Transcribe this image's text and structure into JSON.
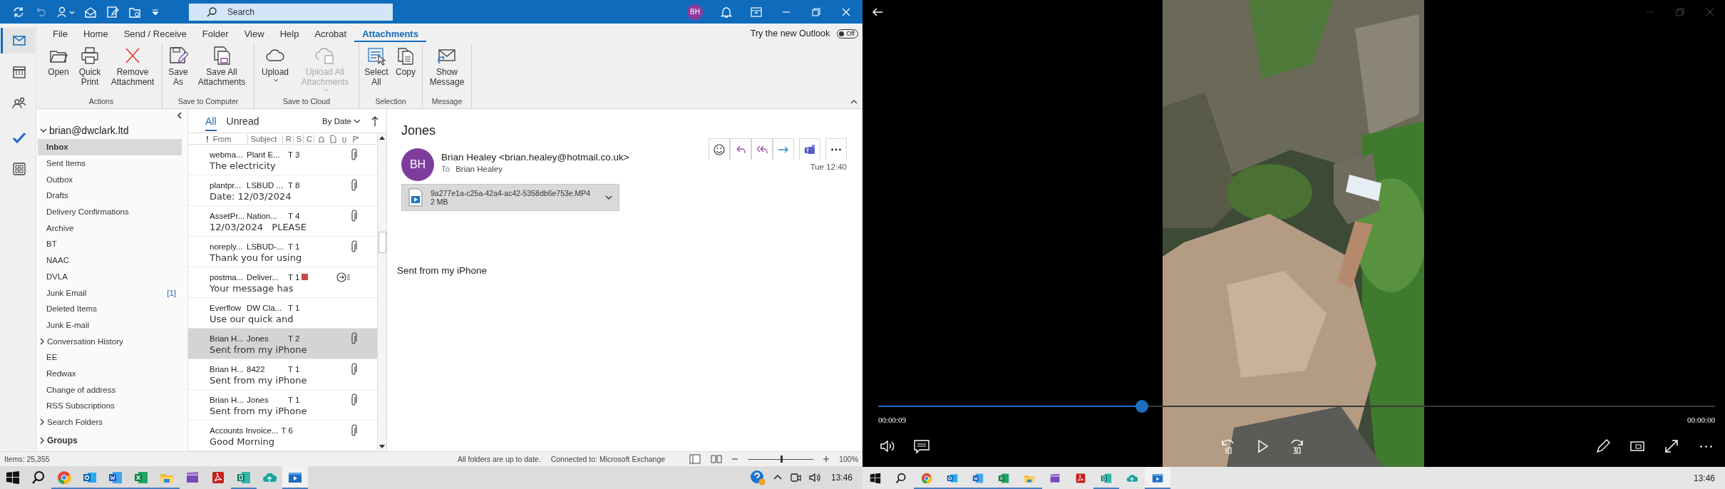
{
  "title_bar": {
    "search": {
      "placeholder": "Search"
    },
    "avatar": "BH"
  },
  "nav": [
    {
      "selected": true
    },
    {
      "selected": false
    },
    {
      "selected": false
    },
    {
      "selected": false
    },
    {
      "selected": false
    }
  ],
  "ribbon": {
    "tabs": [
      {
        "label": "File",
        "selected": false
      },
      {
        "label": "Home",
        "selected": false
      },
      {
        "label": "Send / Receive",
        "selected": false
      },
      {
        "label": "Folder",
        "selected": false
      },
      {
        "label": "View",
        "selected": false
      },
      {
        "label": "Help",
        "selected": false
      },
      {
        "label": "Acrobat",
        "selected": false
      },
      {
        "label": "Attachments",
        "selected": true
      }
    ],
    "new_outlook": {
      "label": "Try the new Outlook",
      "toggle": "Off",
      "on": false
    },
    "groups": [
      {
        "label": "Actions",
        "buttons": [
          {
            "label": "Open",
            "disabled": false,
            "dropdown": false
          },
          {
            "label": "Quick Print",
            "disabled": false,
            "dropdown": false
          },
          {
            "label": "Remove Attachment",
            "disabled": false,
            "dropdown": false
          }
        ]
      },
      {
        "label": "Save to Computer",
        "buttons": [
          {
            "label": "Save As",
            "disabled": false,
            "dropdown": false
          },
          {
            "label": "Save All Attachments",
            "disabled": false,
            "dropdown": false
          }
        ]
      },
      {
        "label": "Save to Cloud",
        "buttons": [
          {
            "label": "Upload",
            "disabled": false,
            "dropdown": true
          },
          {
            "label": "Upload All Attachments",
            "disabled": true,
            "dropdown": true
          }
        ]
      },
      {
        "label": "Selection",
        "buttons": [
          {
            "label": "Select All",
            "disabled": false,
            "dropdown": false
          },
          {
            "label": "Copy",
            "disabled": false,
            "dropdown": false
          }
        ]
      },
      {
        "label": "Message",
        "buttons": [
          {
            "label": "Show Message",
            "disabled": false,
            "dropdown": false
          }
        ]
      }
    ]
  },
  "folders": {
    "account": "brian@dwclark.ltd",
    "items": [
      {
        "label": "Inbox",
        "selected": true,
        "kind": "plain"
      },
      {
        "label": "Sent Items",
        "selected": false,
        "kind": "plain"
      },
      {
        "label": "Outbox",
        "selected": false,
        "kind": "plain"
      },
      {
        "label": "Drafts",
        "selected": false,
        "kind": "plain"
      },
      {
        "label": "Delivery Confirmations",
        "selected": false,
        "kind": "plain"
      },
      {
        "label": "Archive",
        "selected": false,
        "kind": "plain"
      },
      {
        "label": "BT",
        "selected": false,
        "kind": "plain"
      },
      {
        "label": "NAAC",
        "selected": false,
        "kind": "plain"
      },
      {
        "label": "DVLA",
        "selected": false,
        "kind": "plain"
      },
      {
        "label": "Junk Email",
        "selected": false,
        "kind": "plain",
        "count": "[1]"
      },
      {
        "label": "Deleted Items",
        "selected": false,
        "kind": "plain"
      },
      {
        "label": "Junk E-mail",
        "selected": false,
        "kind": "plain"
      },
      {
        "label": "Conversation History",
        "selected": false,
        "kind": "expandable"
      },
      {
        "label": "EE",
        "selected": false,
        "kind": "plain"
      },
      {
        "label": "Redwax",
        "selected": false,
        "kind": "plain"
      },
      {
        "label": "Change of address",
        "selected": false,
        "kind": "plain"
      },
      {
        "label": "RSS Subscriptions",
        "selected": false,
        "kind": "plain"
      },
      {
        "label": "Search Folders",
        "selected": false,
        "kind": "expandable"
      }
    ],
    "groups": "Groups"
  },
  "message_list": {
    "filters": [
      {
        "label": "All",
        "selected": true
      },
      {
        "label": "Unread",
        "selected": false
      }
    ],
    "sort": "By Date",
    "columns": [
      "!",
      "From",
      "Subject",
      "R",
      "S",
      "C"
    ],
    "rows": [
      {
        "from": "webma...",
        "subject": "Plant E...",
        "size": "T 3",
        "preview": "The electricity",
        "kind": "attachment",
        "tagged": false,
        "selected": false
      },
      {
        "from": "plantpr...",
        "subject": "LSBUD ...",
        "size": "T 8",
        "preview": "Date: 12/03/2024",
        "kind": "attachment",
        "tagged": false,
        "selected": false
      },
      {
        "from": "AssetPr...",
        "subject": "Nation...",
        "size": "T 4",
        "preview": "12/03/2024   PLEASE",
        "kind": "attachment",
        "tagged": false,
        "selected": false
      },
      {
        "from": "noreply...",
        "subject": "LSBUD-...",
        "size": "T 1",
        "preview": "Thank you for using",
        "kind": "attachment",
        "tagged": false,
        "selected": false
      },
      {
        "from": "postma...",
        "subject": "Deliver...",
        "size": "T 1",
        "preview": "Your message has",
        "kind": "receipt",
        "tagged": true,
        "selected": false
      },
      {
        "from": "Everflow",
        "subject": "DW Cla...",
        "size": "T 1",
        "preview": "Use our quick and",
        "kind": "plain",
        "tagged": false,
        "selected": false
      },
      {
        "from": "Brian H...",
        "subject": "Jones",
        "size": "T 2",
        "preview": "Sent from my iPhone",
        "kind": "attachment",
        "tagged": false,
        "selected": true
      },
      {
        "from": "Brian H...",
        "subject": "8422",
        "size": "T 1",
        "preview": "Sent from my iPhone",
        "kind": "attachment",
        "tagged": false,
        "selected": false
      },
      {
        "from": "Brian H...",
        "subject": "Jones",
        "size": "T 1",
        "preview": "Sent from my iPhone",
        "kind": "attachment",
        "tagged": false,
        "selected": false
      },
      {
        "from": "Accounts Invoice...",
        "size": "T 6",
        "preview": "Good Morning",
        "kind": "attachment",
        "tagged": false,
        "selected": false
      }
    ]
  },
  "reading_pane": {
    "subject": "Jones",
    "initials": "BH",
    "sender": "Brian Healey <brian.healey@hotmail.co.uk>",
    "to_label": "To",
    "to": "Brian Healey",
    "time": "Tue 12:40",
    "attachment": {
      "name": "9a277e1a-c25a-42a4-ac42-5358db6e753e.MP4",
      "size": "2 MB"
    },
    "body": "Sent from my iPhone"
  },
  "status_bar": {
    "items": "Items: 25,355",
    "sync": "All folders are up to date.",
    "connection": "Connected to: Microsoft Exchange",
    "zoom": {
      "level": 0.5,
      "reading": "100%"
    }
  },
  "player": {
    "progress": {
      "level": 0.315
    },
    "elapsed": "00:00:09",
    "total": "00:00:00"
  },
  "taskbars": [
    {
      "apps": [
        {
          "running": false,
          "selected": false
        },
        {
          "running": false,
          "selected": false
        },
        {
          "running": true,
          "selected": false
        },
        {
          "running": true,
          "selected": false
        },
        {
          "running": true,
          "selected": false
        },
        {
          "running": true,
          "selected": false
        },
        {
          "running": true,
          "selected": false
        },
        {
          "running": false,
          "selected": false
        },
        {
          "running": false,
          "selected": false
        },
        {
          "running": true,
          "selected": false
        },
        {
          "running": false,
          "selected": false
        },
        {
          "running": true,
          "selected": true
        }
      ],
      "time": "13:46",
      "tray": true
    },
    {
      "apps": [
        {
          "running": false,
          "selected": false
        },
        {
          "running": false,
          "selected": false
        },
        {
          "running": true,
          "selected": false
        },
        {
          "running": true,
          "selected": false
        },
        {
          "running": true,
          "selected": false
        },
        {
          "running": true,
          "selected": false
        },
        {
          "running": true,
          "selected": false
        },
        {
          "running": false,
          "selected": false
        },
        {
          "running": false,
          "selected": false
        },
        {
          "running": true,
          "selected": false
        },
        {
          "running": false,
          "selected": false
        },
        {
          "running": true,
          "selected": true
        }
      ],
      "time": "13:46",
      "tray": false
    }
  ]
}
